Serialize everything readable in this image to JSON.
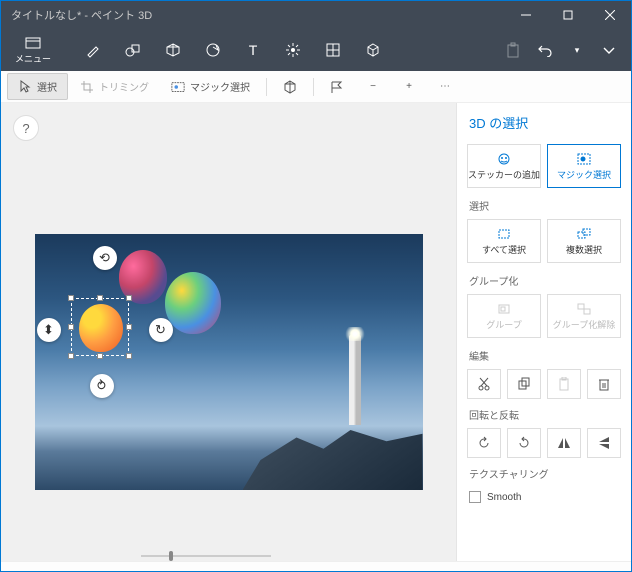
{
  "titlebar": {
    "title": "タイトルなし* - ペイント 3D"
  },
  "ribbon": {
    "menu_label": "メニュー"
  },
  "toolbar": {
    "select_label": "選択",
    "trim_label": "トリミング",
    "magic_label": "マジック選択"
  },
  "side": {
    "title": "3D の選択",
    "sticker_label": "ステッカーの追加",
    "magic_label": "マジック選択",
    "section_select": "選択",
    "select_all": "すべて選択",
    "multi_select": "複数選択",
    "section_group": "グループ化",
    "group": "グループ",
    "ungroup": "グループ化解除",
    "section_edit": "編集",
    "section_rotate": "回転と反転",
    "section_texture": "テクスチャリング",
    "smooth": "Smooth"
  },
  "help": "?"
}
